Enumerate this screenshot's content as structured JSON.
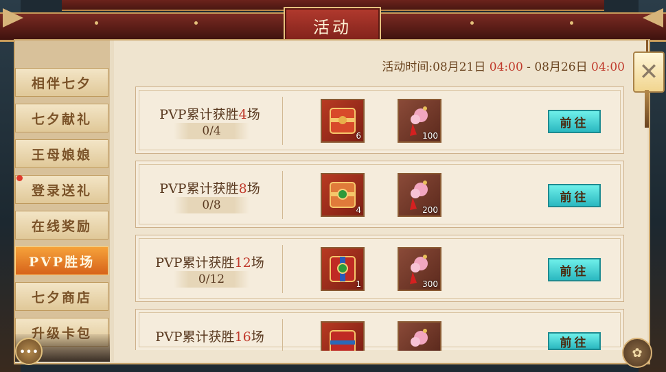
{
  "header": {
    "title": "活动"
  },
  "activity_time": {
    "label": "活动时间:",
    "start_date": "08月21日",
    "start_time": "04:00",
    "separator": "-",
    "end_date": "08月26日",
    "end_time": "04:00"
  },
  "sidebar": {
    "items": [
      {
        "label": "相伴七夕",
        "active": false,
        "red_dot": false
      },
      {
        "label": "七夕献礼",
        "active": false,
        "red_dot": false
      },
      {
        "label": "王母娘娘",
        "active": false,
        "red_dot": false
      },
      {
        "label": "登录送礼",
        "active": false,
        "red_dot": true
      },
      {
        "label": "在线奖励",
        "active": false,
        "red_dot": false
      },
      {
        "label": "PVP胜场",
        "active": true,
        "red_dot": false
      },
      {
        "label": "七夕商店",
        "active": false,
        "red_dot": false
      },
      {
        "label": "升级卡包",
        "active": false,
        "red_dot": false
      }
    ]
  },
  "rows": [
    {
      "title_prefix": "PVP累计获胜",
      "title_num": "4",
      "title_suffix": "场",
      "progress": "0/4",
      "rewards": [
        {
          "icon": "red-gift-box-icon",
          "count": "6"
        },
        {
          "icon": "pink-flower-tassel-icon",
          "count": "100"
        }
      ],
      "button": "前往"
    },
    {
      "title_prefix": "PVP累计获胜",
      "title_num": "8",
      "title_suffix": "场",
      "progress": "0/8",
      "rewards": [
        {
          "icon": "jade-gift-box-icon",
          "count": "4"
        },
        {
          "icon": "pink-flower-tassel-icon",
          "count": "200"
        }
      ],
      "button": "前往"
    },
    {
      "title_prefix": "PVP累计获胜",
      "title_num": "12",
      "title_suffix": "场",
      "progress": "0/12",
      "rewards": [
        {
          "icon": "jade-gift-box-icon",
          "count": "1"
        },
        {
          "icon": "pink-flower-tassel-icon",
          "count": "300"
        }
      ],
      "button": "前往"
    },
    {
      "title_prefix": "PVP累计获胜",
      "title_num": "16",
      "title_suffix": "场",
      "progress": "",
      "rewards": [
        {
          "icon": "red-gift-box-icon",
          "count": ""
        },
        {
          "icon": "pink-flower-tassel-icon",
          "count": ""
        }
      ],
      "button": "前往"
    }
  ],
  "colors": {
    "highlight": "#c0392b",
    "button": "#3cc8cc",
    "active_tab": "#e8812a"
  },
  "icons": {
    "close": "close-icon",
    "chat": "chat-icon",
    "settings": "gear-icon"
  }
}
